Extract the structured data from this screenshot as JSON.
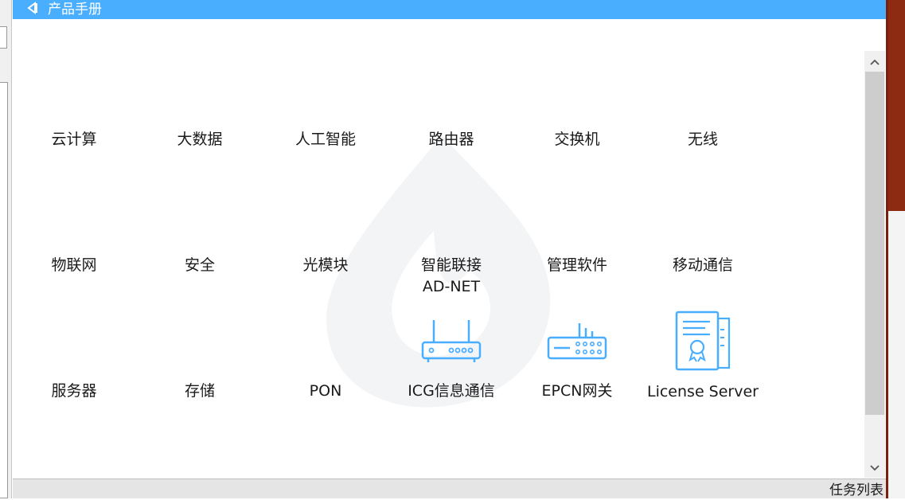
{
  "header": {
    "title": "产品手册",
    "back_icon": "back-triangle-icon",
    "background": "#4aaeff"
  },
  "grid": {
    "rows": [
      [
        {
          "label": "云计算"
        },
        {
          "label": "大数据"
        },
        {
          "label": "人工智能"
        },
        {
          "label": "路由器"
        },
        {
          "label": "交换机"
        },
        {
          "label": "无线"
        }
      ],
      [
        {
          "label": "物联网"
        },
        {
          "label": "安全"
        },
        {
          "label": "光模块"
        },
        {
          "label": "智能联接",
          "label2": "AD-NET"
        },
        {
          "label": "管理软件"
        },
        {
          "label": "移动通信"
        }
      ],
      [
        {
          "label": "服务器"
        },
        {
          "label": "存储"
        },
        {
          "label": "PON"
        },
        {
          "label": "ICG信息通信",
          "icon": "router-antenna-icon"
        },
        {
          "label": "EPCN网关",
          "icon": "gateway-icon"
        },
        {
          "label": "License Server",
          "icon": "certificate-icon"
        }
      ]
    ]
  },
  "icon_color": "#4aaeff",
  "footer": {
    "taskbar_label": "任务列表"
  }
}
